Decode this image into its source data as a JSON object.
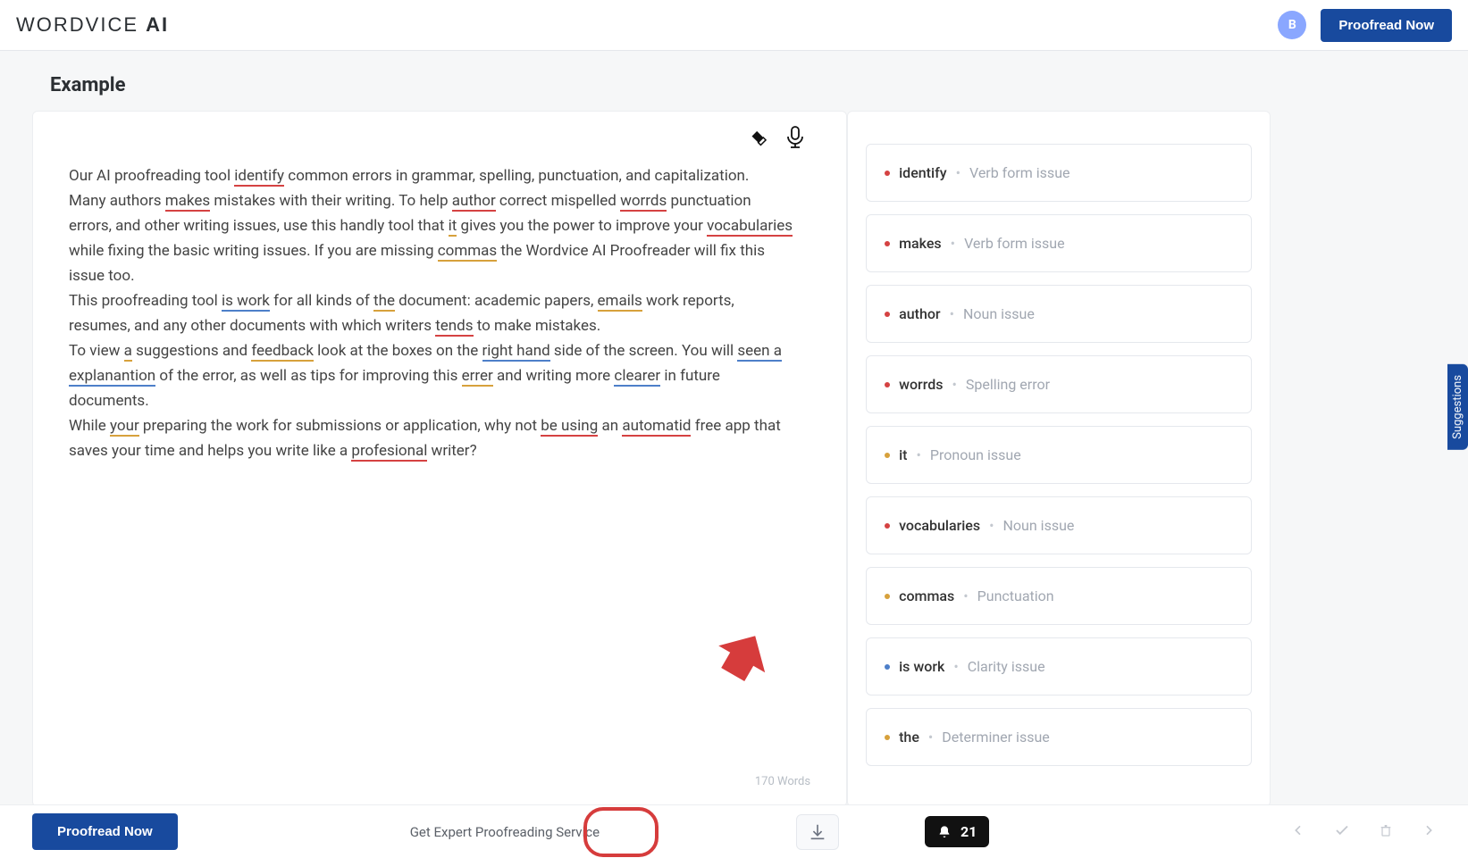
{
  "header": {
    "logo_text": "WORDVICE AI",
    "avatar_initial": "B",
    "proofread_label": "Proofread Now"
  },
  "page": {
    "title": "Example"
  },
  "editor": {
    "paragraphs": [
      {
        "runs": [
          {
            "t": "Our AI proofreading tool "
          },
          {
            "t": "identify",
            "ul": "red"
          },
          {
            "t": " common errors in grammar, spelling, punctuation, and capitalization."
          }
        ]
      },
      {
        "runs": [
          {
            "t": "Many authors "
          },
          {
            "t": "makes",
            "ul": "red"
          },
          {
            "t": " mistakes with their writing. To help "
          },
          {
            "t": "author",
            "ul": "red"
          },
          {
            "t": " correct mispelled "
          },
          {
            "t": "worrds",
            "ul": "red"
          },
          {
            "t": " punctuation errors, and other writing issues, use this handly tool that "
          },
          {
            "t": "it",
            "ul": "org"
          },
          {
            "t": " gives you the power to improve your "
          },
          {
            "t": "vocabularies",
            "ul": "red"
          },
          {
            "t": " while fixing the basic writing issues. If you are missing "
          },
          {
            "t": "commas",
            "ul": "org"
          },
          {
            "t": " the Wordvice AI Proofreader will fix this issue too."
          }
        ]
      },
      {
        "runs": [
          {
            "t": "This proofreading tool "
          },
          {
            "t": "is work",
            "ul": "blue"
          },
          {
            "t": " for all kinds of "
          },
          {
            "t": "the",
            "ul": "org"
          },
          {
            "t": " document: academic papers, "
          },
          {
            "t": "emails",
            "ul": "org"
          },
          {
            "t": " work reports, resumes, and any other documents with which writers "
          },
          {
            "t": "tends",
            "ul": "red"
          },
          {
            "t": " to make mistakes."
          }
        ]
      },
      {
        "runs": [
          {
            "t": "To view "
          },
          {
            "t": "a",
            "ul": "org"
          },
          {
            "t": " suggestions and "
          },
          {
            "t": "feedback",
            "ul": "org"
          },
          {
            "t": " look at the boxes on the "
          },
          {
            "t": "right hand",
            "ul": "blue"
          },
          {
            "t": " side of the screen. You will "
          },
          {
            "t": "seen a explanantion",
            "ul": "blue"
          },
          {
            "t": " of the error, as well as tips for improving this "
          },
          {
            "t": "errer",
            "ul": "org"
          },
          {
            "t": " and writing more "
          },
          {
            "t": "clearer",
            "ul": "blue"
          },
          {
            "t": " in future documents."
          }
        ]
      },
      {
        "runs": [
          {
            "t": "While "
          },
          {
            "t": "your",
            "ul": "org"
          },
          {
            "t": " preparing the work for submissions or application, why not "
          },
          {
            "t": "be using",
            "ul": "red"
          },
          {
            "t": " an "
          },
          {
            "t": "automatid",
            "ul": "red"
          },
          {
            "t": " free app that saves your time and helps you write like a "
          },
          {
            "t": "profesional",
            "ul": "red"
          },
          {
            "t": " writer?"
          }
        ]
      }
    ],
    "word_count_label": "170 Words"
  },
  "suggestions": {
    "tab_label": "Suggestions",
    "items": [
      {
        "word": "identify",
        "type": "Verb form issue",
        "color": "red"
      },
      {
        "word": "makes",
        "type": "Verb form issue",
        "color": "red"
      },
      {
        "word": "author",
        "type": "Noun issue",
        "color": "red"
      },
      {
        "word": "worrds",
        "type": "Spelling error",
        "color": "red"
      },
      {
        "word": "it",
        "type": "Pronoun issue",
        "color": "org"
      },
      {
        "word": "vocabularies",
        "type": "Noun issue",
        "color": "red"
      },
      {
        "word": "commas",
        "type": "Punctuation",
        "color": "org"
      },
      {
        "word": "is work",
        "type": "Clarity issue",
        "color": "blue"
      },
      {
        "word": "the",
        "type": "Determiner issue",
        "color": "org"
      }
    ]
  },
  "footer": {
    "proofread_label": "Proofread Now",
    "expert_link": "Get Expert Proofreading Service",
    "badge_count": "21"
  }
}
